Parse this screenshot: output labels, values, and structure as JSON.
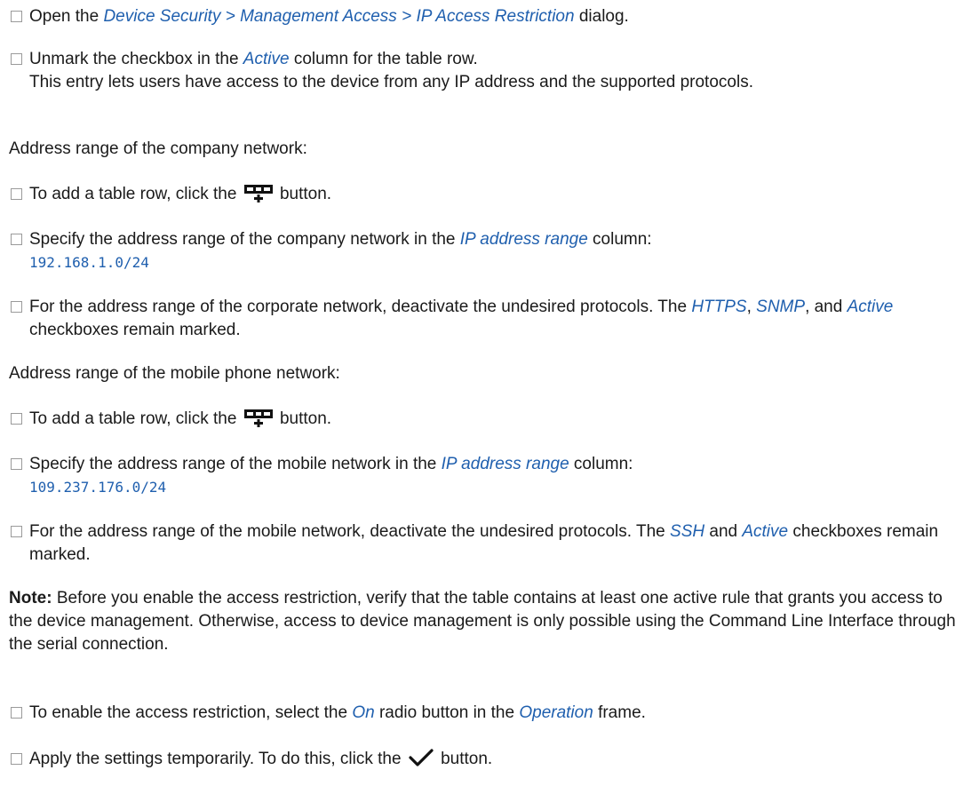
{
  "steps": {
    "s1": {
      "pre": "Open the ",
      "ref": "Device Security > Management Access > IP Access Restriction",
      "post": " dialog."
    },
    "s2": {
      "pre": "Unmark the checkbox in the ",
      "ref": "Active",
      "post": " column for the table row.",
      "line2": "This entry lets users have access to the device from any IP address and the supported protocols."
    },
    "p_company": "Address range of the company network:",
    "s3": {
      "pre": "To add a table row, click the ",
      "icon": "add-row-icon",
      "post": " button."
    },
    "s4": {
      "pre": "Specify the address range of the company network in the ",
      "ref": "IP address range",
      "post": " column:",
      "code": "192.168.1.0/24"
    },
    "s5": {
      "pre": "For the address range of the corporate network, deactivate the undesired protocols. The ",
      "ref1": "HTTPS",
      "sep1": ", ",
      "ref2": "SNMP",
      "sep2": ", and ",
      "ref3": "Active",
      "post": " checkboxes remain marked."
    },
    "p_mobile": "Address range of the mobile phone network:",
    "s6": {
      "pre": "To add a table row, click the ",
      "icon": "add-row-icon",
      "post": " button."
    },
    "s7": {
      "pre": "Specify the address range of the mobile network in the ",
      "ref": "IP address range",
      "post": " column:",
      "code": "109.237.176.0/24"
    },
    "s8": {
      "pre": "For the address range of the mobile network, deactivate the undesired protocols. The ",
      "ref1": "SSH",
      "mid": " and ",
      "ref2": "Active",
      "post": " checkboxes remain marked."
    },
    "note": {
      "label": "Note:",
      "text": " Before you enable the access restriction, verify that the table contains at least one active rule that grants you access to the device management. Otherwise, access to device management is only possible using the Command Line Interface through the serial connection."
    },
    "s9": {
      "pre": "To enable the access restriction, select the ",
      "ref1": "On",
      "mid": " radio button in the ",
      "ref2": "Operation",
      "post": " frame."
    },
    "s10": {
      "pre": "Apply the settings temporarily. To do this, click the ",
      "icon": "checkmark-icon",
      "post": " button."
    }
  },
  "colors": {
    "reference": "#1f5fae",
    "text": "#1a1a1a",
    "checkbox_border": "#9a9a9a"
  }
}
